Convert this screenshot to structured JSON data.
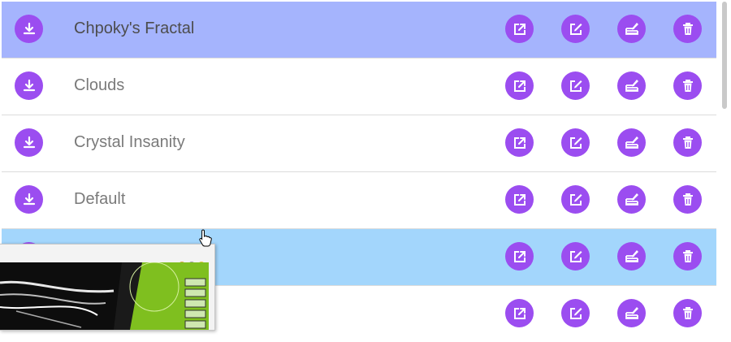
{
  "list": {
    "rows": [
      {
        "name": "Chpoky's Fractal",
        "state": "selected"
      },
      {
        "name": "Clouds",
        "state": "normal"
      },
      {
        "name": "Crystal Insanity",
        "state": "normal"
      },
      {
        "name": "Default",
        "state": "normal"
      },
      {
        "name": "",
        "state": "hovered"
      },
      {
        "name": "",
        "state": "normal"
      }
    ]
  },
  "icons": {
    "download": "download-icon",
    "open": "open-external-icon",
    "edit": "edit-icon",
    "edit_code": "edit-code-icon",
    "delete": "trash-icon"
  },
  "colors": {
    "accent": "#9b4df0",
    "selected_row": "#a5b4fd",
    "hovered_row": "#a3d6fc",
    "text": "#7a7a7a"
  }
}
